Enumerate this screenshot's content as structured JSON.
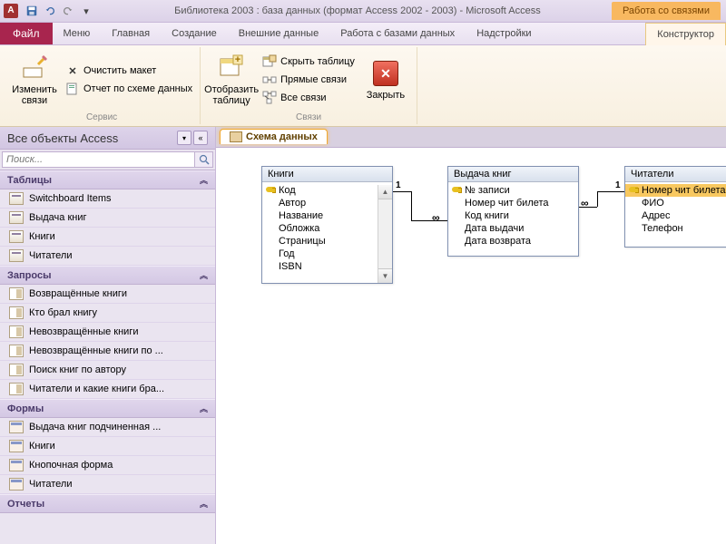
{
  "title": "Библиотека 2003 : база данных (формат Access 2002 - 2003)  -  Microsoft Access",
  "context_group": "Работа со связями",
  "menu": {
    "file": "Файл",
    "items": [
      "Меню",
      "Главная",
      "Создание",
      "Внешние данные",
      "Работа с базами данных",
      "Надстройки"
    ],
    "constructor": "Конструктор"
  },
  "ribbon": {
    "group1": {
      "edit": "Изменить\nсвязи",
      "clear": "Очистить макет",
      "report": "Отчет по схеме данных",
      "label": "Сервис"
    },
    "group2": {
      "show": "Отобразить\nтаблицу",
      "hide": "Скрыть таблицу",
      "direct": "Прямые связи",
      "all": "Все связи",
      "close": "Закрыть",
      "label": "Связи"
    }
  },
  "nav": {
    "title": "Все объекты Access",
    "search_placeholder": "Поиск...",
    "sections": {
      "tables": {
        "label": "Таблицы",
        "items": [
          "Switchboard Items",
          "Выдача книг",
          "Книги",
          "Читатели"
        ]
      },
      "queries": {
        "label": "Запросы",
        "items": [
          "Возвращённые книги",
          "Кто брал книгу",
          "Невозвращённые книги",
          "Невозвращённые книги по ...",
          "Поиск книг по автору",
          "Читатели и какие книги бра..."
        ]
      },
      "forms": {
        "label": "Формы",
        "items": [
          "Выдача книг подчиненная ...",
          "Книги",
          "Кнопочная форма",
          "Читатели"
        ]
      },
      "reports": {
        "label": "Отчеты"
      }
    }
  },
  "doc_tab": "Схема данных",
  "tables": {
    "t1": {
      "title": "Книги",
      "fields": [
        "Код",
        "Автор",
        "Название",
        "Обложка",
        "Страницы",
        "Год",
        "ISBN"
      ],
      "key": 0
    },
    "t2": {
      "title": "Выдача книг",
      "fields": [
        "№ записи",
        "Номер чит билета",
        "Код книги",
        "Дата выдачи",
        "Дата возврата"
      ],
      "key": 0
    },
    "t3": {
      "title": "Читатели",
      "fields": [
        "Номер чит билета",
        "ФИО",
        "Адрес",
        "Телефон"
      ],
      "key": 0,
      "sel": 0
    }
  },
  "rel": {
    "one": "1",
    "many": "∞"
  }
}
